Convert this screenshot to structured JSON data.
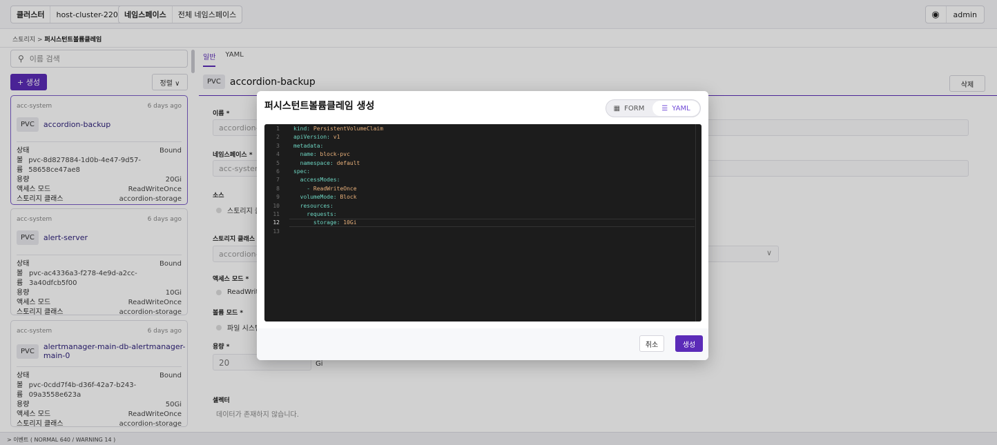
{
  "topbar": {
    "cluster_label": "클러스터",
    "cluster_value": "host-cluster-220",
    "namespace_label": "네임스페이스",
    "namespace_value": "전체 네임스페이스",
    "user_name": "admin"
  },
  "breadcrumb": {
    "parent": "스토리지",
    "separator": ">",
    "current": "퍼시스턴트볼륨클레임"
  },
  "list": {
    "search_placeholder": "이름 검색",
    "create_label": "+ 생성",
    "sort_label": "정렬 ∨",
    "items": [
      {
        "namespace": "acc-system",
        "age": "6 days ago",
        "kind": "PVC",
        "name": "accordion-backup",
        "rows": [
          [
            "상태",
            "Bound"
          ],
          [
            "볼륨",
            "pvc-8d827884-1d0b-4e47-9d57-58658ce47ae8"
          ],
          [
            "용량",
            "20Gi"
          ],
          [
            "액세스 모드",
            "ReadWriteOnce"
          ],
          [
            "스토리지 클래스",
            "accordion-storage"
          ]
        ]
      },
      {
        "namespace": "acc-system",
        "age": "6 days ago",
        "kind": "PVC",
        "name": "alert-server",
        "rows": [
          [
            "상태",
            "Bound"
          ],
          [
            "볼륨",
            "pvc-ac4336a3-f278-4e9d-a2cc-3a40dfcb5f00"
          ],
          [
            "용량",
            "10Gi"
          ],
          [
            "액세스 모드",
            "ReadWriteOnce"
          ],
          [
            "스토리지 클래스",
            "accordion-storage"
          ]
        ]
      },
      {
        "namespace": "acc-system",
        "age": "6 days ago",
        "kind": "PVC",
        "name": "alertmanager-main-db-alertmanager-main-0",
        "rows": [
          [
            "상태",
            "Bound"
          ],
          [
            "볼륨",
            "pvc-0cdd7f4b-d36f-42a7-b243-09a3558e623a"
          ],
          [
            "용량",
            "50Gi"
          ],
          [
            "액세스 모드",
            "ReadWriteOnce"
          ],
          [
            "스토리지 클래스",
            "accordion-storage"
          ]
        ]
      }
    ]
  },
  "events_bar": "> 이벤트 ( NORMAL 640 / WARNING 14 )",
  "detail": {
    "tabs": [
      "일반",
      "YAML"
    ],
    "kind": "PVC",
    "name": "accordion-backup",
    "delete_label": "삭제",
    "fields": {
      "name_label": "이름 *",
      "name_value": "accordion-backup",
      "namespace_label": "네임스페이스 *",
      "namespace_value": "acc-system",
      "source_label": "소스",
      "source_option": "스토리지 클",
      "storage_class_label": "스토리지 클래스 *",
      "storage_class_value": "accordion-st",
      "access_mode_label": "액세스 모드 *",
      "access_mode_option": "ReadWrite",
      "volume_mode_label": "볼륨 모드 *",
      "volume_mode_option": "파일 시스템",
      "capacity_label": "용량 *",
      "capacity_value": "20",
      "capacity_unit": "Gi",
      "selector_label": "셀렉터",
      "selector_empty": "데이터가 존재하지 않습니다."
    }
  },
  "modal": {
    "title": "퍼시스턴트볼륨클레임 생성",
    "toggle_form": "FORM",
    "toggle_yaml": "YAML",
    "cancel_label": "취소",
    "create_label": "생성",
    "current_line": 12,
    "yaml_lines": [
      {
        "k": "kind: ",
        "v": "PersistentVolumeClaim"
      },
      {
        "k": "apiVersion: ",
        "v": "v1"
      },
      {
        "k": "metadata:",
        "v": ""
      },
      {
        "k": "  name: ",
        "v": "block-pvc"
      },
      {
        "k": "  namespace: ",
        "v": "default"
      },
      {
        "k": "spec:",
        "v": ""
      },
      {
        "k": "  accessModes:",
        "v": ""
      },
      {
        "k": "    - ",
        "v": "ReadWriteOnce"
      },
      {
        "k": "  volumeMode: ",
        "v": "Block"
      },
      {
        "k": "  resources:",
        "v": ""
      },
      {
        "k": "    requests:",
        "v": ""
      },
      {
        "k": "      storage: ",
        "v": "10Gi"
      },
      {
        "k": "",
        "v": ""
      }
    ]
  }
}
